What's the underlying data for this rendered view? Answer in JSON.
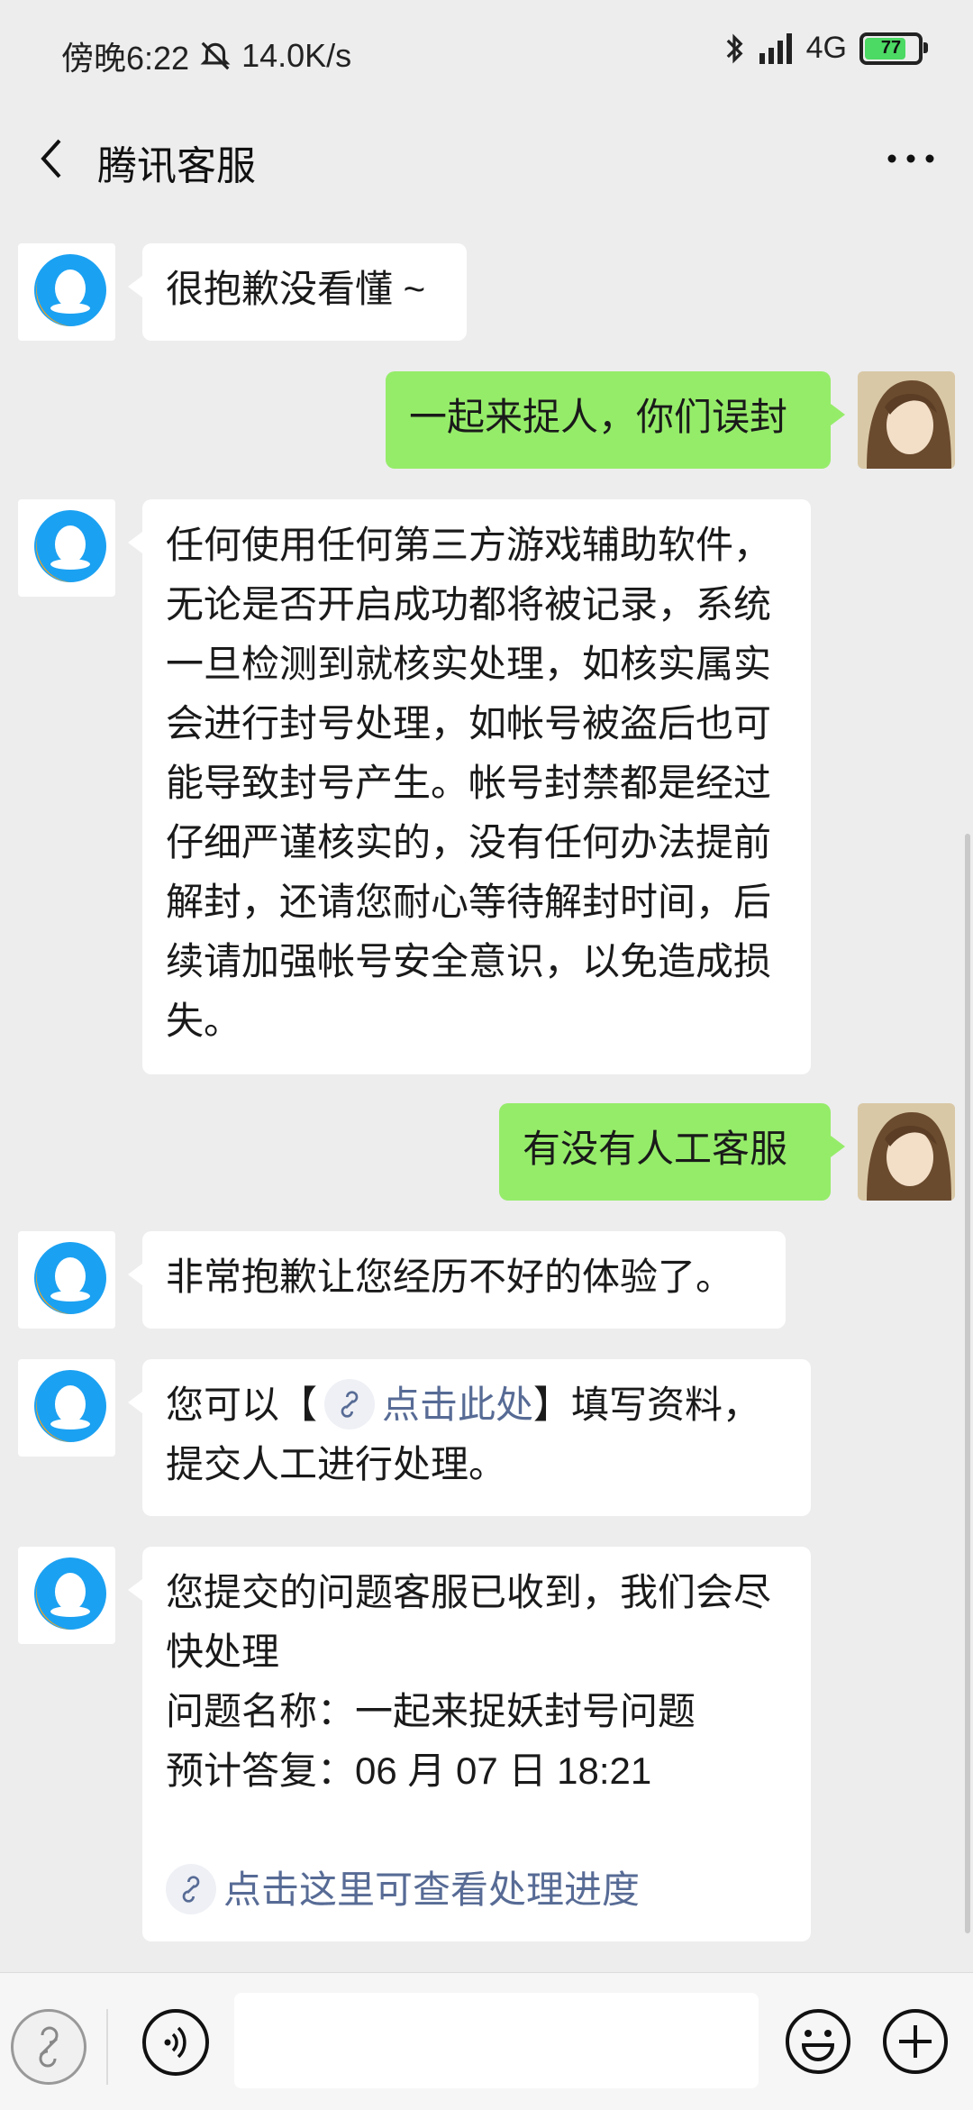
{
  "status": {
    "time": "傍晚6:22",
    "speed": "14.0K/s",
    "network": "4G",
    "battery": "77"
  },
  "header": {
    "title": "腾讯客服"
  },
  "messages": {
    "m1": "很抱歉没看懂 ~",
    "m2": "一起来捉人，你们误封",
    "m3": "任何使用任何第三方游戏辅助软件，无论是否开启成功都将被记录，系统一旦检测到就核实处理，如核实属实会进行封号处理，如帐号被盗后也可能导致封号产生。帐号封禁都是经过仔细严谨核实的，没有任何办法提前解封，还请您耐心等待解封时间，后续请加强帐号安全意识，以免造成损失。",
    "m4": "有没有人工客服",
    "m5": "非常抱歉让您经历不好的体验了。",
    "m6": {
      "prefix": "您可以【",
      "link": "点击此处",
      "suffix": "】填写资料，提交人工进行处理。"
    },
    "m7": {
      "line1": "您提交的问题客服已收到，我们会尽快处理",
      "line2": "问题名称：一起来捉妖封号问题",
      "line3": "预计答复：06 月 07 日 18:21",
      "link": "点击这里可查看处理进度"
    }
  },
  "icons": {
    "back": "chevron-left-icon",
    "more": "more-dots-icon",
    "voice": "voice-icon",
    "emoji": "emoji-icon",
    "plus": "plus-icon",
    "mini": "mini-program-icon"
  },
  "colors": {
    "bubble_self": "#95ec69",
    "link": "#576b95",
    "background": "#ededed"
  }
}
